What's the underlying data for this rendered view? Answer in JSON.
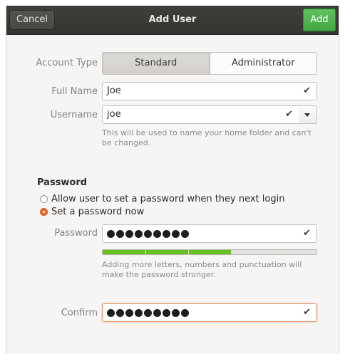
{
  "header": {
    "title": "Add User",
    "cancel_label": "Cancel",
    "add_label": "Add"
  },
  "account_type": {
    "label": "Account Type",
    "options": [
      "Standard",
      "Administrator"
    ],
    "selected": "Standard"
  },
  "full_name": {
    "label": "Full Name",
    "value": "Joe"
  },
  "username": {
    "label": "Username",
    "value": "joe",
    "hint": "This will be used to name your home folder and can't be changed."
  },
  "password_section": {
    "title": "Password",
    "option_later": "Allow user to set a password when they next login",
    "option_now": "Set a password now",
    "selected": "option_now",
    "password_label": "Password",
    "password_dots": 9,
    "strength_fraction": 0.6,
    "strength_hint": "Adding more letters, numbers and punctuation will make the password stronger.",
    "confirm_label": "Confirm",
    "confirm_dots": 9
  },
  "icons": {
    "valid": "check-icon",
    "dropdown": "chevron-down-icon",
    "radio": "radio-icon"
  },
  "colors": {
    "accent": "#e9652b",
    "add_button": "#4caf4f",
    "strength": "#66c01f"
  }
}
